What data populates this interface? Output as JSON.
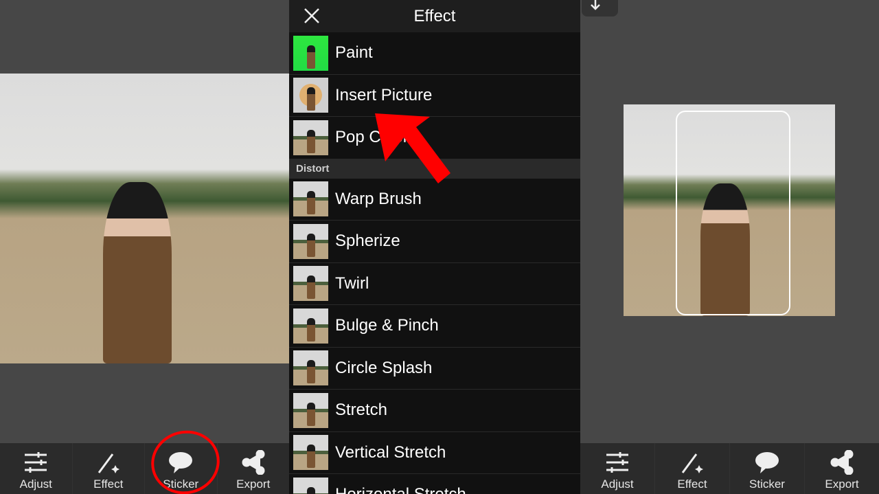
{
  "toolbar": {
    "items": [
      {
        "label": "Adjust"
      },
      {
        "label": "Effect"
      },
      {
        "label": "Sticker"
      },
      {
        "label": "Export"
      }
    ]
  },
  "effect_panel": {
    "title": "Effect",
    "items_top": [
      {
        "label": "Paint"
      },
      {
        "label": "Insert Picture"
      },
      {
        "label": "Pop Color"
      }
    ],
    "section": "Distort",
    "items_distort": [
      {
        "label": "Warp Brush"
      },
      {
        "label": "Spherize"
      },
      {
        "label": "Twirl"
      },
      {
        "label": "Bulge & Pinch"
      },
      {
        "label": "Circle Splash"
      },
      {
        "label": "Stretch"
      },
      {
        "label": "Vertical Stretch"
      },
      {
        "label": "Horizontal Stretch"
      }
    ]
  },
  "colors": {
    "annotation": "#ff0000",
    "panel_bg": "#111111",
    "app_bg": "#474747",
    "toolbar_bg": "#2b2b2b"
  }
}
